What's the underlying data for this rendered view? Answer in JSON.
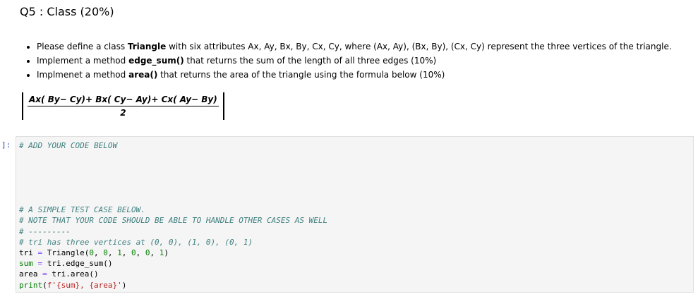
{
  "question": {
    "title": "Q5 : Class (20%)"
  },
  "instructions": {
    "b1_pre": "Please define a class ",
    "b1_bold": "Triangle",
    "b1_post": " with six attributes Ax, Ay, Bx, By, Cx, Cy, where (Ax, Ay), (Bx, By), (Cx, Cy) represent the three vertices of the triangle.",
    "b2_pre": "Implement a method ",
    "b2_bold": "edge_sum()",
    "b2_post": " that returns the sum of the length of all three edges (10%)",
    "b3_pre": "Implmenet a method ",
    "b3_bold": "area()",
    "b3_post": " that returns the area of the triangle using the formula below (10%)"
  },
  "formula": {
    "numerator": "Ax( By− Cy)+ Bx( Cy− Ay)+ Cx( Ay− By)",
    "denominator": "2"
  },
  "cell": {
    "prompt": "]:",
    "line1": "# ADD YOUR CODE BELOW",
    "line7": "# A SIMPLE TEST CASE BELOW.",
    "line8": "# NOTE THAT YOUR CODE SHOULD BE ABLE TO HANDLE OTHER CASES AS WELL",
    "line9": "# ---------",
    "line10": "# tri has three vertices at (0, 0), (1, 0), (0, 1)",
    "l11_var": "tri",
    "l11_eq": "=",
    "l11_call": "Triangle(",
    "l11_args": [
      "0",
      "0",
      "1",
      "0",
      "0",
      "1"
    ],
    "l11_close": ")",
    "l12_var": "sum",
    "l12_eq": "=",
    "l12_rhs": "tri.edge_sum()",
    "l13_var": "area",
    "l13_eq": "=",
    "l13_rhs": "tri.area()",
    "l14_fn": "print",
    "l14_open": "(",
    "l14_str": "f'{sum}, {area}'",
    "l14_close": ")"
  }
}
